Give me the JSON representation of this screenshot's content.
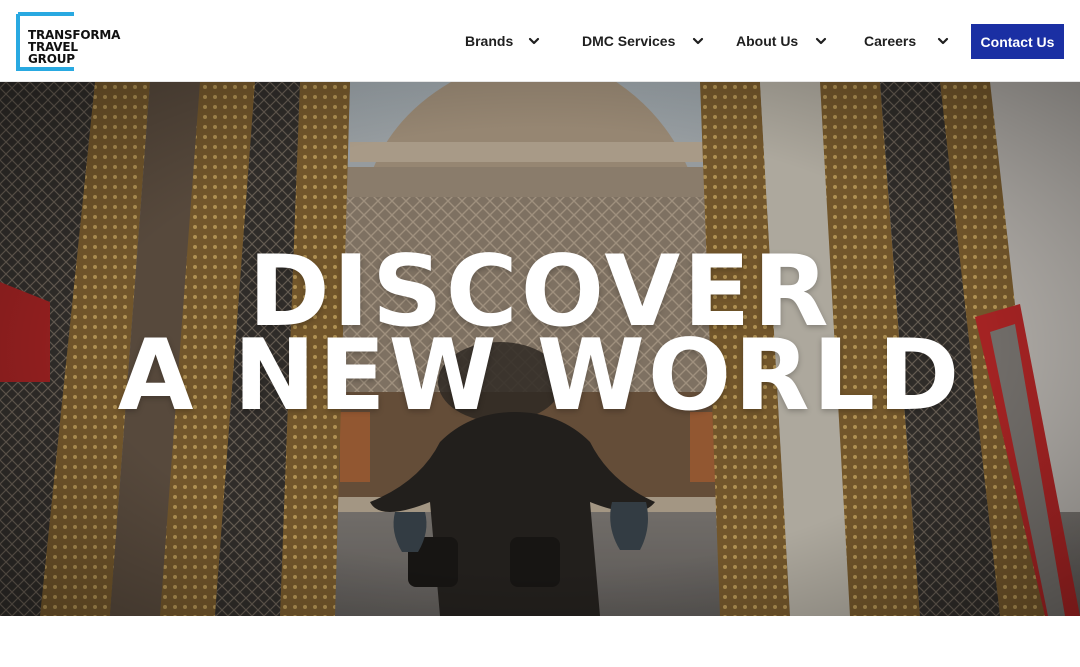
{
  "logo": {
    "line1": "TRANSFORMA",
    "line2": "TRAVEL GROUP",
    "accent": "#29a9e1"
  },
  "nav": {
    "items": [
      {
        "label": "Brands"
      },
      {
        "label": "DMC Services"
      },
      {
        "label": "About Us"
      },
      {
        "label": "Careers"
      }
    ],
    "contact_label": "Contact Us",
    "contact_color": "#1a2fa3"
  },
  "hero": {
    "line1": "DISCOVER",
    "line2": "A NEW WORLD"
  },
  "icons": {
    "dropdown": "chevron-down-icon"
  }
}
